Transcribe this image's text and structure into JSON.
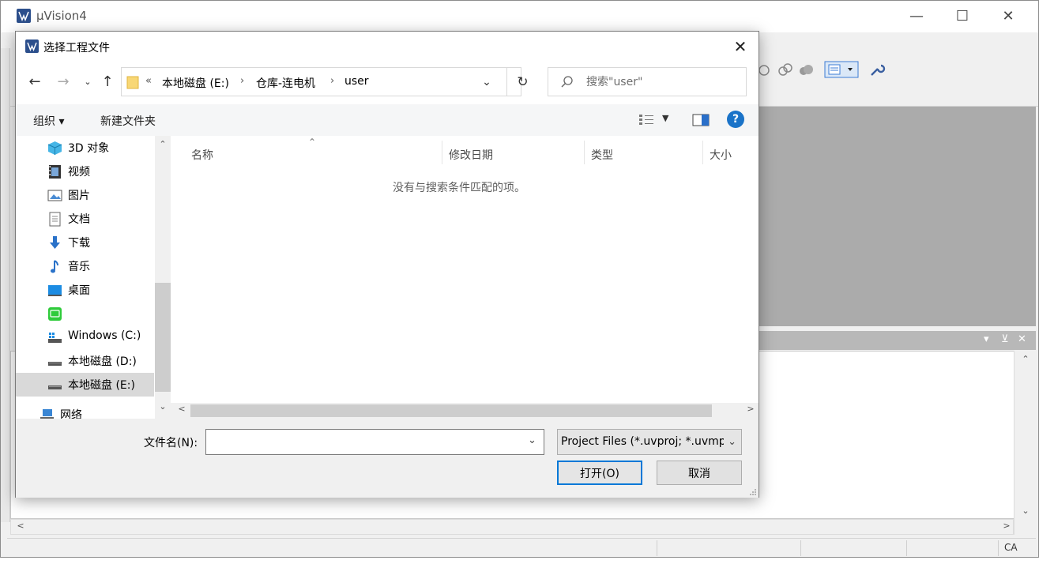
{
  "main_window": {
    "title": "µVision4",
    "status_text": "CA"
  },
  "dialog": {
    "title": "选择工程文件",
    "address": {
      "overflow": "«",
      "crumbs": [
        "本地磁盘 (E:)",
        "仓库-连电机",
        "user"
      ]
    },
    "search": {
      "placeholder": "搜索\"user\""
    },
    "command_bar": {
      "organize": "组织 ▾",
      "new_folder": "新建文件夹"
    },
    "nav_pane": {
      "items": [
        {
          "label": "3D 对象",
          "icon": "3d-objects-icon"
        },
        {
          "label": "视频",
          "icon": "video-icon"
        },
        {
          "label": "图片",
          "icon": "pictures-icon"
        },
        {
          "label": "文档",
          "icon": "documents-icon"
        },
        {
          "label": "下载",
          "icon": "downloads-icon"
        },
        {
          "label": "音乐",
          "icon": "music-icon"
        },
        {
          "label": "桌面",
          "icon": "desktop-icon"
        },
        {
          "label": "",
          "icon": "app-shortcut-icon"
        },
        {
          "label": "Windows (C:)",
          "icon": "windows-drive-icon"
        },
        {
          "label": "本地磁盘 (D:)",
          "icon": "drive-icon"
        },
        {
          "label": "本地磁盘 (E:)",
          "icon": "drive-icon",
          "selected": true
        },
        {
          "label": "网络",
          "icon": "network-icon"
        }
      ]
    },
    "file_list": {
      "columns": [
        "名称",
        "修改日期",
        "类型",
        "大小"
      ],
      "empty_message": "没有与搜索条件匹配的项。"
    },
    "bottom": {
      "filename_label": "文件名(N):",
      "filename_value": "",
      "filetype": "Project Files (*.uvproj; *.uvmp",
      "open_label": "打开(O)",
      "cancel_label": "取消"
    }
  },
  "colors": {
    "accent": "#0078d7",
    "help": "#1a73c8",
    "selected": "#d9d9d9",
    "editor_gray": "#ababab"
  }
}
